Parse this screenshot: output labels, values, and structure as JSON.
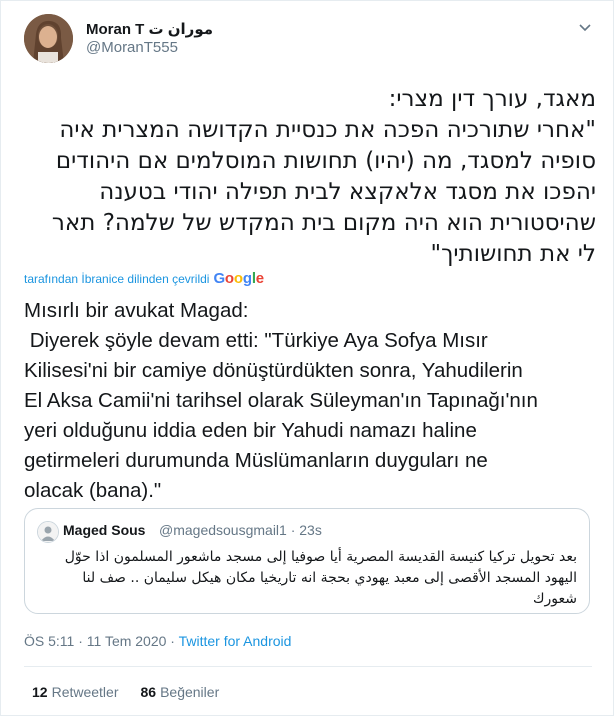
{
  "author": {
    "name": "Moran T موران ت",
    "handle": "@MoranT555"
  },
  "tweet_hebrew_lines": [
    "מאגד, עורך דין מצרי:",
    "\"אחרי שתורכיה הפכה את כנסיית הקדושה המצרית איה",
    "סופיה למסגד, מה (יהיו) תחושות המוסלמים אם היהודים",
    "יהפכו את מסגד אלאקצא לבית תפילה יהודי בטענה",
    "שהיסטורית הוא היה מקום בית המקדש של שלמה? תאר",
    "לי את תחושותיך\""
  ],
  "translation": {
    "note": "tarafından İbranice dilinden çevrildi",
    "provider": "Google"
  },
  "tweet_turkish_lines": [
    "Mısırlı bir avukat Magad:",
    " Diyerek şöyle devam etti: \"Türkiye Aya Sofya Mısır",
    "Kilisesi'ni bir camiye dönüştürdükten sonra, Yahudilerin",
    "El Aksa Camii'ni tarihsel olarak Süleyman'ın Tapınağı'nın",
    "yeri olduğunu iddia eden bir Yahudi namazı haline",
    "getirmeleri durumunda Müslümanların duyguları ne",
    "olacak (bana).\""
  ],
  "quoted_tweet": {
    "name": "Maged Sous",
    "handle_time": "@magedsousgmail1 · 23s",
    "text_lines": [
      "بعد تحويل تركيا كنيسة القديسة المصرية أيا صوفيا إلى مسجد ماشعور المسلمون اذا حوّل",
      "اليهود المسجد الأقصى إلى معبد يهودي بحجة انه تاريخيا مكان هيكل سليمان .. صف لنا",
      "شعورك"
    ]
  },
  "meta": {
    "time_date": "ÖS 5:11 · 11 Tem 2020 · ",
    "app": "Twitter for Android"
  },
  "stats": {
    "retweets_count": "12",
    "retweets_label": "Retweetler",
    "likes_count": "86",
    "likes_label": "Beğeniler"
  },
  "colors": {
    "link": "#1b95e0",
    "secondary": "#657786",
    "text": "#14171a",
    "border": "#e6ecf0"
  }
}
